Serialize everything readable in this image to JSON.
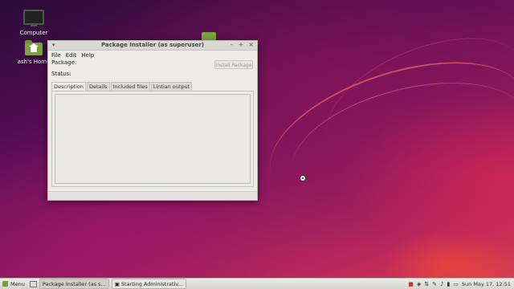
{
  "desktop": {
    "icons": [
      {
        "label": "Computer"
      },
      {
        "label": "ash's Home"
      }
    ]
  },
  "window": {
    "title": "Package Installer (as superuser)",
    "menu": [
      "File",
      "Edit",
      "Help"
    ],
    "package_label": "Package:",
    "status_label": "Status:",
    "install_button": "Install Package",
    "tabs": [
      "Description",
      "Details",
      "Included files",
      "Lintian output"
    ],
    "active_tab": "Description"
  },
  "taskbar": {
    "menu_label": "Menu",
    "tasks": [
      {
        "label": "Package Installer (as s...",
        "active": true
      },
      {
        "label": "Starting Administrativ...",
        "active": false
      }
    ],
    "clock": "Sun May 17, 12:51"
  }
}
